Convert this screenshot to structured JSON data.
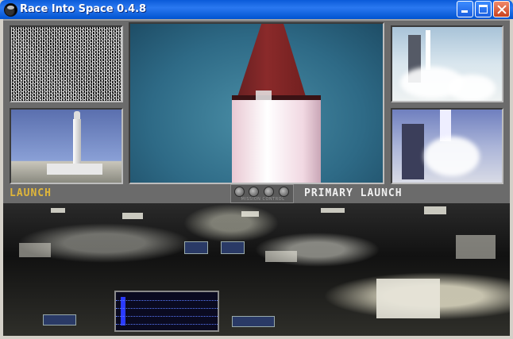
{
  "window": {
    "title": "Race Into Space 0.4.8",
    "controls": {
      "minimize_icon": "minimize-icon",
      "maximize_icon": "maximize-icon",
      "close_icon": "close-icon"
    }
  },
  "game": {
    "left_label": "LAUNCH",
    "right_label": "PRIMARY LAUNCH",
    "mission_control_label": "MISSION CONTROL",
    "colors": {
      "left_label": "#e0b63a",
      "right_label": "#f0f0f0",
      "panel": "#6b6b6b"
    }
  }
}
